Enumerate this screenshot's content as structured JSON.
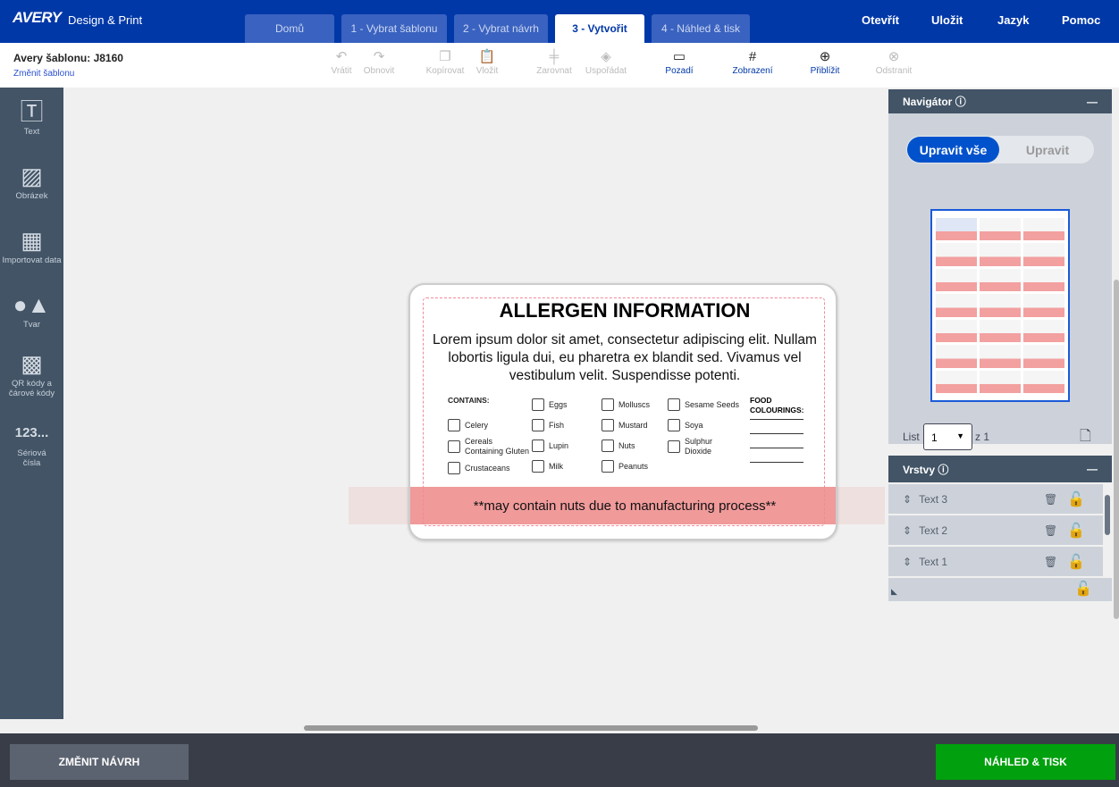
{
  "header": {
    "logo": "AVERY",
    "app": "Design & Print",
    "tabs": [
      {
        "label": "Domů"
      },
      {
        "label": "1 - Vybrat šablonu"
      },
      {
        "label": "2 - Vybrat návrh"
      },
      {
        "label": "3 - Vytvořit",
        "active": true
      },
      {
        "label": "4 - Náhled & tisk"
      }
    ],
    "nav": [
      "Otevřít",
      "Uložit",
      "Jazyk",
      "Pomoc"
    ]
  },
  "toolbar": {
    "template_title": "Avery šablonu: J8160",
    "change_template": "Změnit šablonu",
    "tools": [
      {
        "label": "Vrátit",
        "icon": "undo-icon"
      },
      {
        "label": "Obnovit",
        "icon": "redo-icon"
      },
      {
        "label": "Kopírovat",
        "icon": "copy-icon"
      },
      {
        "label": "Vložit",
        "icon": "paste-icon"
      },
      {
        "label": "Zarovnat",
        "icon": "align-icon"
      },
      {
        "label": "Uspořádat",
        "icon": "arrange-icon"
      },
      {
        "label": "Pozadí",
        "icon": "background-icon"
      },
      {
        "label": "Zobrazení",
        "icon": "grid-icon"
      },
      {
        "label": "Přiblížit",
        "icon": "zoom-icon"
      },
      {
        "label": "Odstranit",
        "icon": "delete-icon"
      }
    ]
  },
  "sidebar": {
    "items": [
      {
        "label": "Text"
      },
      {
        "label": "Obrázek"
      },
      {
        "label": "Importovat data"
      },
      {
        "label": "Tvar"
      },
      {
        "label": "QR kódy a čárové kódy"
      },
      {
        "label": "Sériová čísla",
        "icon_text": "123..."
      }
    ]
  },
  "label": {
    "title": "ALLERGEN INFORMATION",
    "body": "Lorem ipsum dolor sit amet, consectetur adipiscing elit. Nullam lobortis ligula dui, eu pharetra ex blandit sed. Vivamus vel vestibulum velit. Suspendisse potenti.",
    "contains": "CONTAINS:",
    "food": "FOOD COLOURINGS:",
    "allergens": [
      "Celery",
      "Cereals Containing Gluten",
      "Crustaceans",
      "Eggs",
      "Fish",
      "Lupin",
      "Milk",
      "Molluscs",
      "Mustard",
      "Nuts",
      "Peanuts",
      "Sesame Seeds",
      "Soya",
      "Sulphur Dioxide"
    ],
    "footer": "**may contain nuts due to manufacturing process**"
  },
  "navigator": {
    "title": "Navigátor",
    "edit_all": "Upravit vše",
    "edit": "Upravit",
    "sheet_label": "List",
    "sheet_value": "1",
    "of": "z 1"
  },
  "layers": {
    "title": "Vrstvy",
    "items": [
      "Text 3",
      "Text 2",
      "Text 1"
    ]
  },
  "bottom": {
    "change_design": "ZMĚNIT NÁVRH",
    "preview_print": "NÁHLED & TISK"
  },
  "colors": {
    "brand": "#0038a8",
    "sidebar": "#425466",
    "print_button": "#00a00e"
  }
}
